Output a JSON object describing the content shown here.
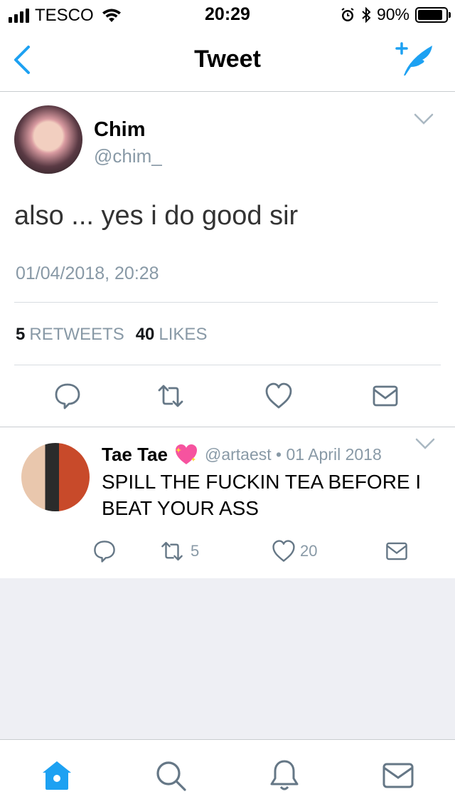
{
  "status_bar": {
    "carrier": "TESCO",
    "time": "20:29",
    "battery": "90%",
    "battery_level": 0.9
  },
  "nav": {
    "title": "Tweet",
    "back_icon": "chevron-left-icon",
    "compose_icon": "compose-tweet-icon"
  },
  "tweet": {
    "name": "Chim",
    "handle": "@chim_",
    "text": "also ... yes i do good sir",
    "timestamp": "01/04/2018, 20:28",
    "retweets_count": "5",
    "retweets_label": "RETWEETS",
    "likes_count": "40",
    "likes_label": "LIKES"
  },
  "reply": {
    "name": "Tae Tae",
    "handle_date": "@artaest • 01 April 2018",
    "text": "SPILL THE FUCKIN TEA BEFORE I BEAT YOUR ASS",
    "retweet_count": "5",
    "like_count": "20"
  },
  "tabbar": {
    "items": [
      "home-icon",
      "search-icon",
      "notifications-icon",
      "messages-icon"
    ]
  },
  "colors": {
    "accent": "#1da1f2",
    "muted": "#8899a6",
    "empty_bg": "#eeeff4"
  }
}
